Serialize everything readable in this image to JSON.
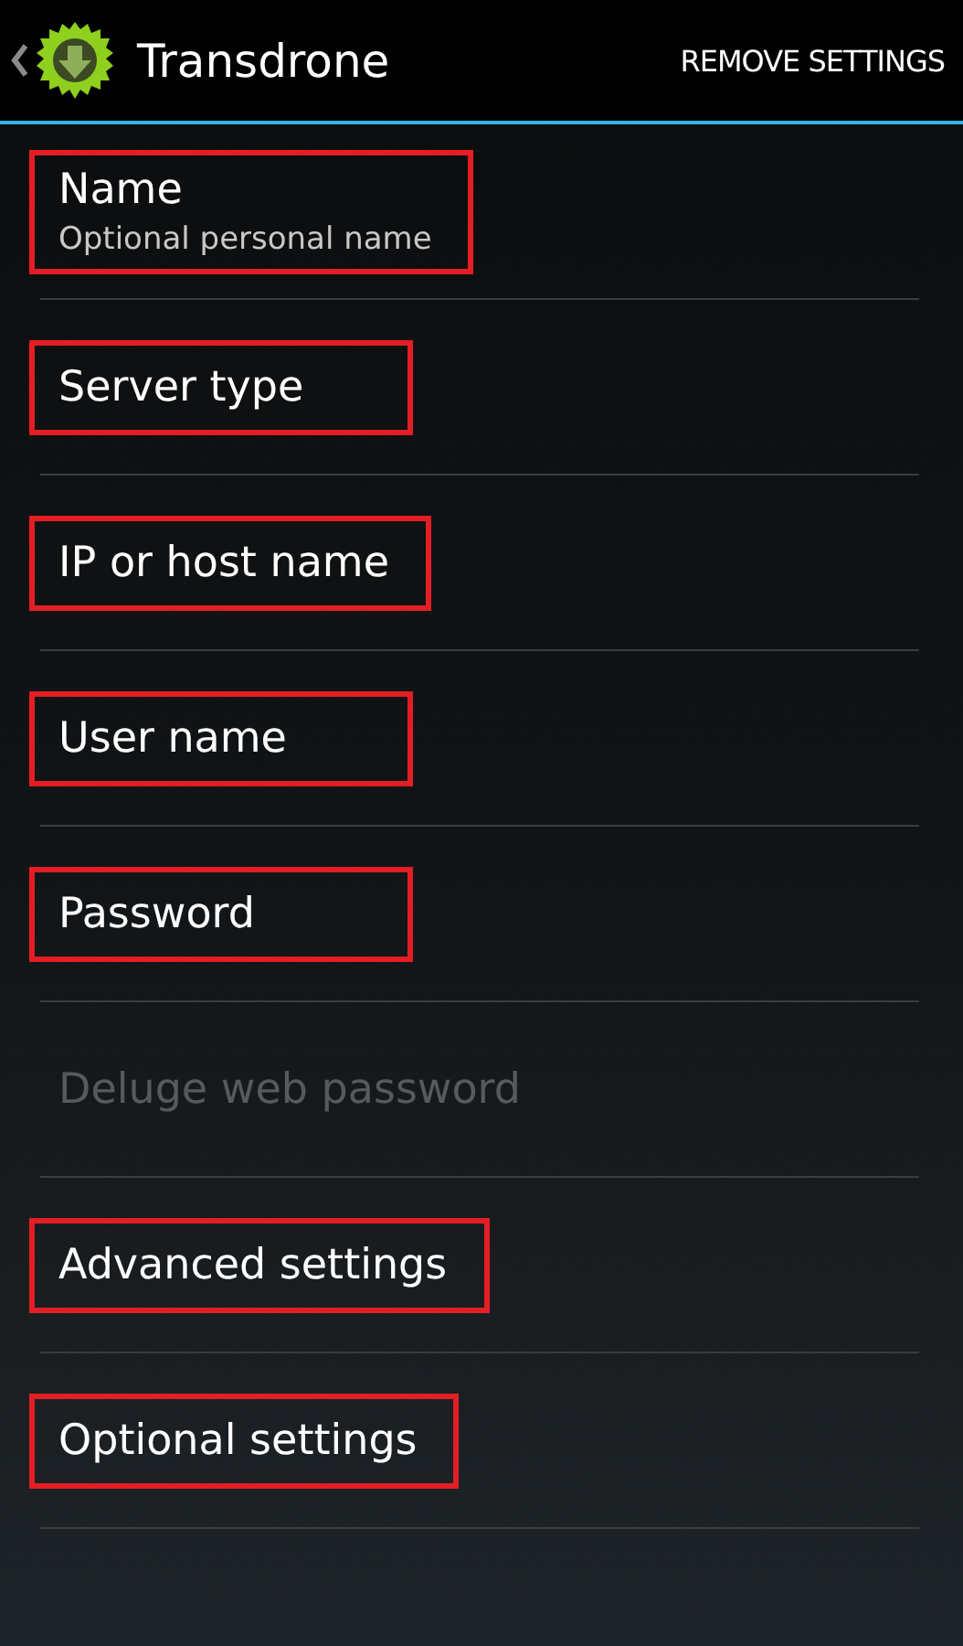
{
  "action_bar": {
    "title": "Transdrone",
    "action": "REMOVE SETTINGS"
  },
  "items": [
    {
      "title": "Name",
      "summary": "Optional personal name",
      "disabled": false,
      "highlighted": true
    },
    {
      "title": "Server type",
      "disabled": false,
      "highlighted": true
    },
    {
      "title": "IP or host name",
      "disabled": false,
      "highlighted": true
    },
    {
      "title": "User name",
      "disabled": false,
      "highlighted": true
    },
    {
      "title": "Password",
      "disabled": false,
      "highlighted": true
    },
    {
      "title": "Deluge web password",
      "disabled": true,
      "highlighted": false
    },
    {
      "title": "Advanced settings",
      "disabled": false,
      "highlighted": true
    },
    {
      "title": "Optional settings",
      "disabled": false,
      "highlighted": true
    }
  ]
}
